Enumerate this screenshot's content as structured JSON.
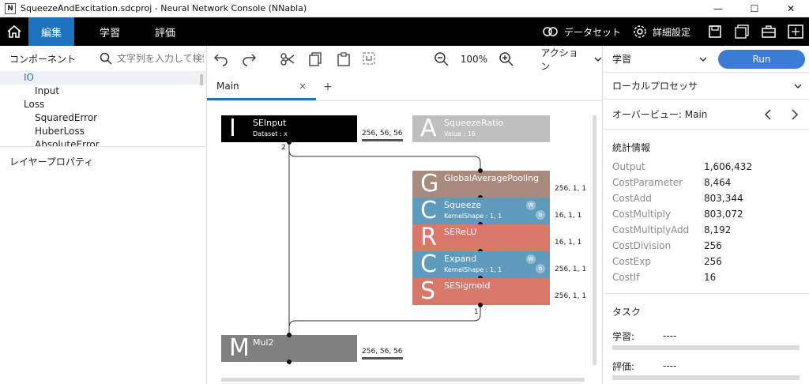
{
  "window": {
    "title": "SqueezeAndExcitation.sdcproj - Neural Network Console (NNabla)",
    "app_icon": "N",
    "controls": [
      "—",
      "☐",
      "✕"
    ]
  },
  "menubar": {
    "tabs": [
      {
        "label": "編集",
        "active": true
      },
      {
        "label": "学習",
        "active": false
      },
      {
        "label": "評価",
        "active": false
      }
    ],
    "dataset_label": "データセット",
    "settings_label": "詳細設定"
  },
  "left_panel": {
    "component_title": "コンポーネント",
    "search_placeholder": "文字列を入力して検索",
    "components": [
      {
        "label": "IO",
        "type": "cat",
        "selected": true
      },
      {
        "label": "Input",
        "type": "sub",
        "selected": false
      },
      {
        "label": "Loss",
        "type": "cat",
        "selected": false
      },
      {
        "label": "SquaredError",
        "type": "sub",
        "selected": false
      },
      {
        "label": "HuberLoss",
        "type": "sub",
        "selected": false
      },
      {
        "label": "AbsoluteError",
        "type": "sub",
        "selected": false
      }
    ],
    "layer_property_title": "レイヤープロパティ"
  },
  "toolbar": {
    "zoom": "100%",
    "action_label": "アクション"
  },
  "doc_tabs": {
    "main_label": "Main",
    "close": "×",
    "add": "+"
  },
  "graph": {
    "colors": {
      "io": "#000000",
      "param": "#bfbfbf",
      "pool": "#a88b7e",
      "conv": "#5f9bbd",
      "act": "#d9776b",
      "math": "#808080"
    },
    "nodes": [
      {
        "id": "seinput",
        "letter": "I",
        "name": "SEInput",
        "param": "Dataset : x",
        "shape": "256, 56, 56",
        "color": "#000000",
        "out_count": "2"
      },
      {
        "id": "squeezeratio",
        "letter": "A",
        "name": "SqueezeRatio",
        "param": "Value : 16",
        "shape": "",
        "color": "#bfbfbf"
      },
      {
        "id": "gap",
        "letter": "G",
        "name": "GlobalAveragePooling",
        "param": "",
        "shape": "256, 1, 1",
        "color": "#a88b7e"
      },
      {
        "id": "squeeze",
        "letter": "C",
        "name": "Squeeze",
        "param": "KernelShape : 1, 1",
        "shape": "16, 1, 1",
        "color": "#5f9bbd"
      },
      {
        "id": "serelu",
        "letter": "R",
        "name": "SEReLU",
        "param": "",
        "shape": "16, 1, 1",
        "color": "#d9776b"
      },
      {
        "id": "expand",
        "letter": "C",
        "name": "Expand",
        "param": "KernelShape : 1, 1",
        "shape": "256, 1, 1",
        "color": "#5f9bbd"
      },
      {
        "id": "sesigmoid",
        "letter": "S",
        "name": "SESigmoid",
        "param": "",
        "shape": "256, 1, 1",
        "color": "#d9776b",
        "out_count": "1"
      },
      {
        "id": "mul2",
        "letter": "M",
        "name": "Mul2",
        "param": "",
        "shape": "256, 56, 56",
        "color": "#808080"
      }
    ],
    "badge_w": "W",
    "badge_b": "b"
  },
  "right_panel": {
    "mode": "学習",
    "run_label": "Run",
    "processor": "ローカルプロセッサ",
    "overview": "オーバービュー: Main",
    "stats_title": "統計情報",
    "stats": [
      {
        "label": "Output",
        "value": "1,606,432"
      },
      {
        "label": "CostParameter",
        "value": "8,464"
      },
      {
        "label": "CostAdd",
        "value": "803,344"
      },
      {
        "label": "CostMultiply",
        "value": "803,072"
      },
      {
        "label": "CostMultiplyAdd",
        "value": "8,192"
      },
      {
        "label": "CostDivision",
        "value": "256"
      },
      {
        "label": "CostExp",
        "value": "256"
      },
      {
        "label": "CostIf",
        "value": "16"
      }
    ],
    "task_title": "タスク",
    "tasks": [
      {
        "label": "学習:",
        "value": "----"
      },
      {
        "label": "評価:",
        "value": "----"
      }
    ]
  }
}
